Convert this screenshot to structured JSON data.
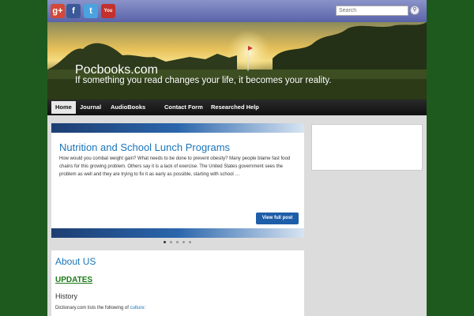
{
  "social": {
    "gplus": "g+",
    "facebook": "f",
    "twitter": "t",
    "youtube": "You"
  },
  "search": {
    "placeholder": "Search"
  },
  "header": {
    "site_title": "Pocbooks.com",
    "tagline": "If something you read changes your life, it becomes your reality."
  },
  "nav": {
    "items": [
      {
        "label": "Home"
      },
      {
        "label": "Journal"
      },
      {
        "label": "AudioBooks"
      },
      {
        "label": "Contact Form"
      },
      {
        "label": "Researched Help"
      }
    ]
  },
  "slider": {
    "post_title": "Nutrition and School Lunch Programs",
    "excerpt": "How would you combat weight gain? What needs to be done to prevent obesity? Many people blame fast food chains for this growing problem. Others say it is a lack of exercise. The United States government sees the problem as well and they are trying to fix it as early as possible, starting with school …",
    "button_label": "View full post",
    "accent_color": "#1b75b7"
  },
  "about": {
    "title": "About US",
    "updates_link": "UPDATES",
    "history": "History",
    "dictionary_text": "Dictionary.com lists the following of",
    "culture_link": "culture:"
  }
}
